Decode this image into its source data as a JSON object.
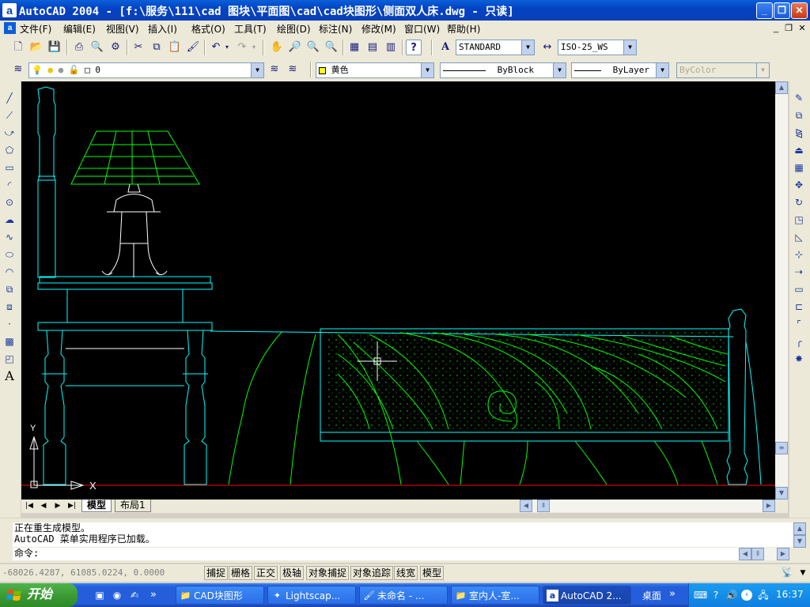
{
  "window": {
    "app_icon": "a",
    "title": "AutoCAD 2004 - [f:\\服务\\111\\cad 图块\\平面图\\cad\\cad块图形\\侧面双人床.dwg - 只读]",
    "minimize": "_",
    "maximize": "❐",
    "close": "✕"
  },
  "menu": {
    "doc_icon": "a",
    "items": [
      "文件(F)",
      "编辑(E)",
      "视图(V)",
      "插入(I)",
      "格式(O)",
      "工具(T)",
      "绘图(D)",
      "标注(N)",
      "修改(M)",
      "窗口(W)",
      "帮助(H)"
    ],
    "doc_min": "_",
    "doc_restore": "❐",
    "doc_close": "✕"
  },
  "standard_toolbar": {
    "text_style": "STANDARD",
    "dim_style": "ISO-25_WS",
    "help_icon": "?"
  },
  "layers_toolbar": {
    "layer_value": "0",
    "color_value": "黄色",
    "linetype_value": "ByBlock",
    "lineweight_value": "ByLayer",
    "plotstyle_value": "ByColor"
  },
  "drawing": {
    "background": "#000000",
    "colors": {
      "cyan": "#00ffff",
      "green": "#00ff00",
      "white": "#ffffff",
      "red": "#ff0000"
    },
    "ucs_y": "Y",
    "ucs_x": "X"
  },
  "tabs": {
    "model": "模型",
    "layout1": "布局1"
  },
  "command": {
    "history": [
      "正在重生成模型。",
      "AutoCAD 菜单实用程序已加载。"
    ],
    "prompt": "命令:"
  },
  "status": {
    "coords": "-68026.4287, 61085.0224, 0.0000",
    "toggles": [
      "捕捉",
      "栅格",
      "正交",
      "极轴",
      "对象捕捉",
      "对象追踪",
      "线宽",
      "模型"
    ]
  },
  "taskbar": {
    "start": "开始",
    "buttons": [
      {
        "label": "CAD块图形",
        "icon": "folder-icon"
      },
      {
        "label": "Lightscap...",
        "icon": "lightscape-icon"
      },
      {
        "label": "未命名 - ...",
        "icon": "paint-icon"
      },
      {
        "label": "室内人-室...",
        "icon": "folder-icon"
      },
      {
        "label": "AutoCAD 2...",
        "icon": "autocad-icon"
      }
    ],
    "desktop": "桌面",
    "chevron": "»",
    "time": "16:37"
  }
}
